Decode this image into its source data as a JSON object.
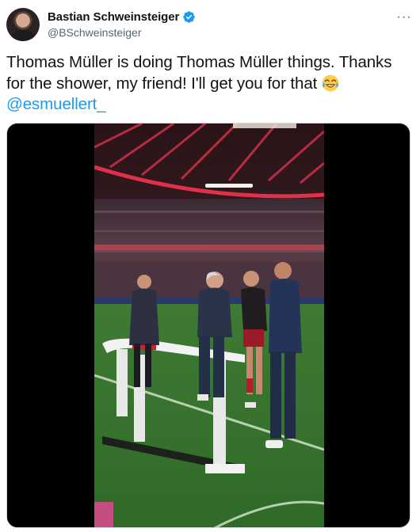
{
  "tweet": {
    "author": {
      "display_name": "Bastian Schweinsteiger",
      "handle": "@BSchweinsteiger",
      "verified": true,
      "avatar_icon": "profile-photo"
    },
    "more_icon": "ellipsis-icon",
    "text_parts": {
      "line1": "Thomas Müller is doing Thomas Müller things. Thanks for the shower, my friend! I'll get you for that",
      "emoji": "😂",
      "mention": "@esmuellert_"
    },
    "media": {
      "type": "video"
    }
  },
  "colors": {
    "text": "#0f1419",
    "secondary": "#536471",
    "link": "#1d9bf0",
    "verified": "#1d9bf0",
    "media_bg": "#000000"
  }
}
